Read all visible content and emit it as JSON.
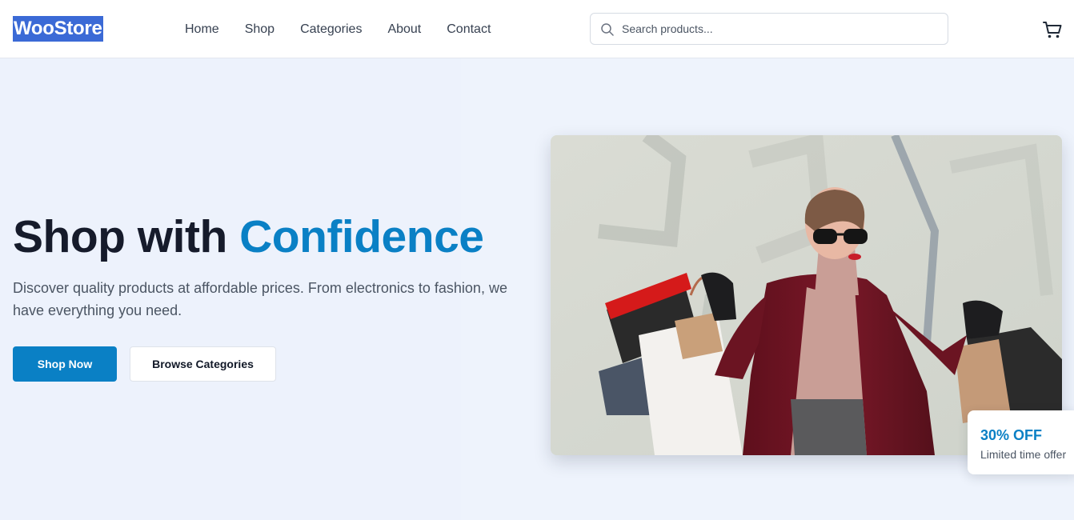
{
  "header": {
    "logo": "WooStore",
    "nav": [
      {
        "label": "Home"
      },
      {
        "label": "Shop"
      },
      {
        "label": "Categories"
      },
      {
        "label": "About"
      },
      {
        "label": "Contact"
      }
    ],
    "search": {
      "placeholder": "Search products...",
      "value": "",
      "icon": "search-icon"
    },
    "cart_icon": "cart-icon"
  },
  "hero": {
    "title_main": "Shop with",
    "title_accent": "Confidence",
    "description": "Discover quality products at affordable prices. From electronics to fashion, we have everything you need.",
    "primary_button": "Shop Now",
    "secondary_button": "Browse Categories",
    "image_alt": "woman holding shopping bags",
    "offer": {
      "title": "30% OFF",
      "subtitle": "Limited time offer"
    }
  },
  "colors": {
    "accent": "#0a80c5",
    "logo_bg": "#3b6ad6",
    "hero_bg": "#eef3fc",
    "heading": "#161b2b"
  }
}
